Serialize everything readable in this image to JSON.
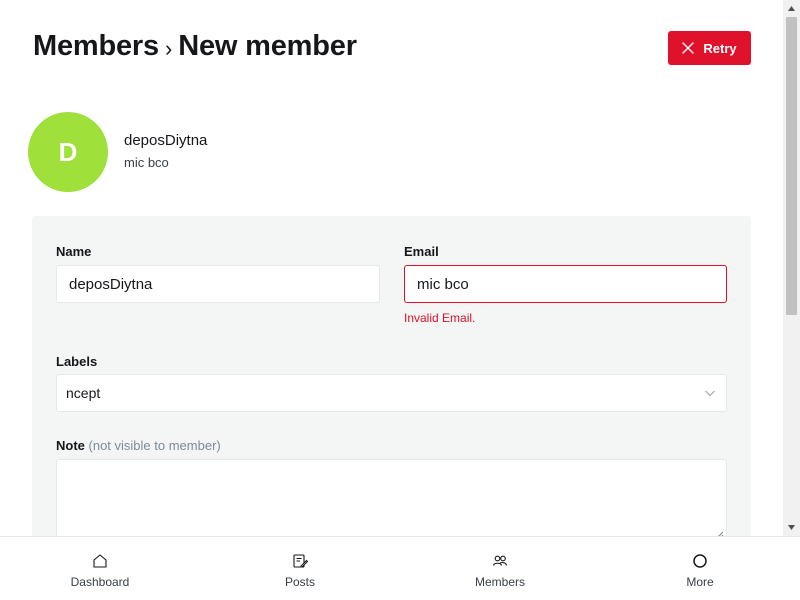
{
  "breadcrumb": {
    "parent": "Members",
    "separator": "›",
    "current": "New member"
  },
  "actions": {
    "retry_label": "Retry"
  },
  "member": {
    "avatar_initial": "D",
    "avatar_color": "#9fe03b",
    "name": "deposDiytna",
    "email": "mic bco"
  },
  "form": {
    "name_label": "Name",
    "name_value": "deposDiytna",
    "email_label": "Email",
    "email_value": "mic bco",
    "email_error": "Invalid Email.",
    "labels_label": "Labels",
    "labels_value": "ncept",
    "note_label": "Note",
    "note_hint": "(not visible to member)",
    "note_value": ""
  },
  "nav": {
    "items": [
      {
        "label": "Dashboard",
        "icon": "home-icon"
      },
      {
        "label": "Posts",
        "icon": "edit-icon"
      },
      {
        "label": "Members",
        "icon": "members-icon"
      },
      {
        "label": "More",
        "icon": "circle-icon"
      }
    ]
  },
  "colors": {
    "accent_red": "#e0112b",
    "card_bg": "#f4f5f5",
    "text": "#15171a"
  }
}
